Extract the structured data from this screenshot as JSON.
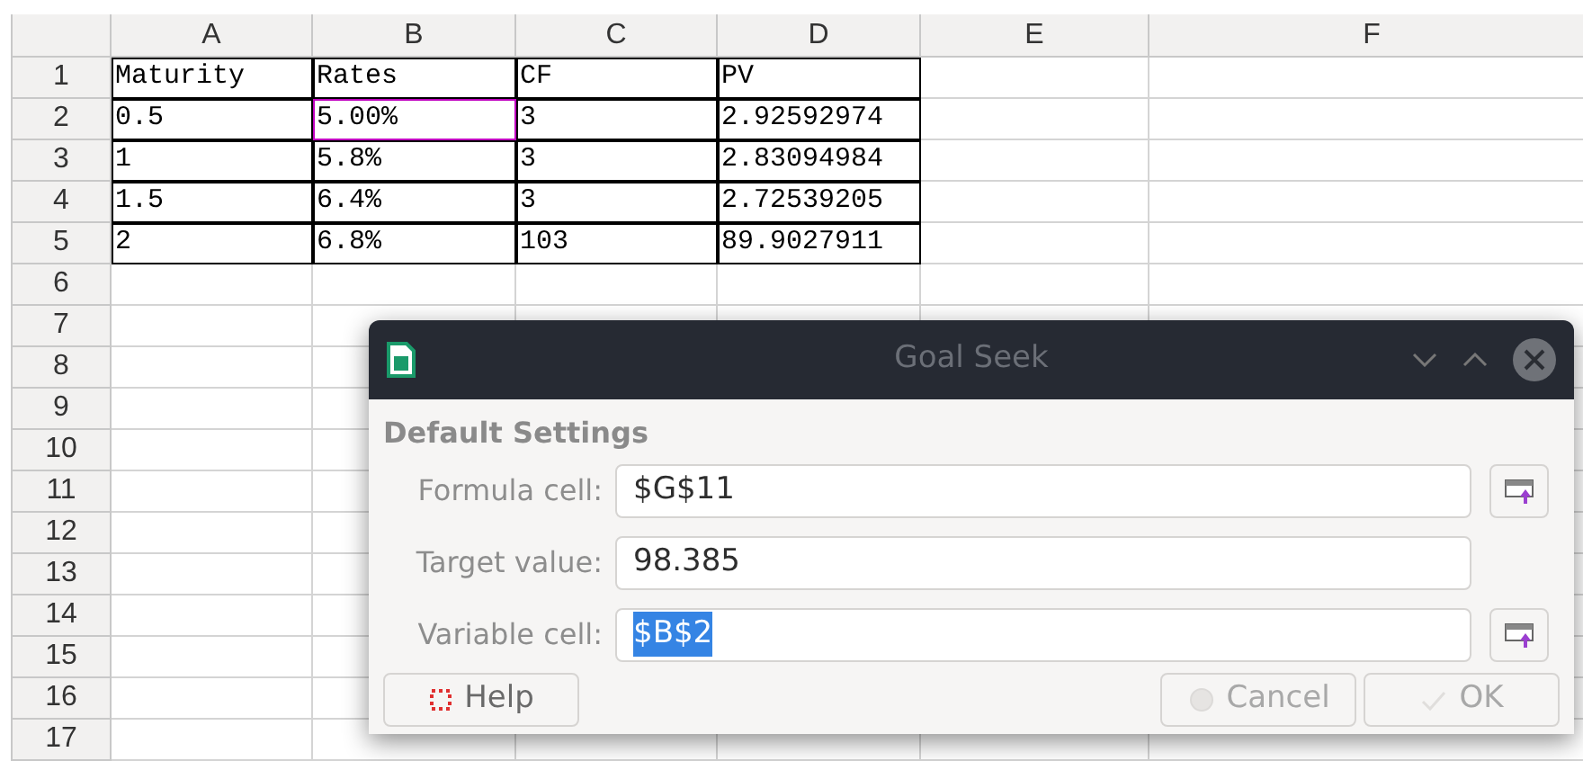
{
  "columns": [
    "A",
    "B",
    "C",
    "D",
    "E",
    "F"
  ],
  "rows": [
    {
      "header": "1",
      "cells": [
        {
          "text": "Maturity",
          "selected": false
        },
        {
          "text": "Rates",
          "selected": false
        },
        {
          "text": "CF",
          "selected": false
        },
        {
          "text": "PV",
          "selected": false
        }
      ]
    },
    {
      "header": "2",
      "cells": [
        {
          "text": "0.5",
          "selected": false
        },
        {
          "text": "5.00%",
          "selected": true
        },
        {
          "text": "3",
          "selected": false
        },
        {
          "text": "2.92592974",
          "selected": false
        }
      ]
    },
    {
      "header": "3",
      "cells": [
        {
          "text": "1",
          "selected": false
        },
        {
          "text": "5.8%",
          "selected": false
        },
        {
          "text": "3",
          "selected": false
        },
        {
          "text": "2.83094984",
          "selected": false
        }
      ]
    },
    {
      "header": "4",
      "cells": [
        {
          "text": "1.5",
          "selected": false
        },
        {
          "text": "6.4%",
          "selected": false
        },
        {
          "text": "3",
          "selected": false
        },
        {
          "text": "2.72539205",
          "selected": false
        }
      ]
    },
    {
      "header": "5",
      "cells": [
        {
          "text": "2",
          "selected": false
        },
        {
          "text": "6.8%",
          "selected": false
        },
        {
          "text": "103",
          "selected": false
        },
        {
          "text": "89.9027911",
          "selected": false
        }
      ]
    },
    {
      "header": "6"
    },
    {
      "header": "7"
    },
    {
      "header": "8"
    },
    {
      "header": "9"
    },
    {
      "header": "10"
    },
    {
      "header": "11"
    },
    {
      "header": "12"
    },
    {
      "header": "13"
    },
    {
      "header": "14"
    },
    {
      "header": "15"
    },
    {
      "header": "16"
    },
    {
      "header": "17"
    }
  ],
  "dialog": {
    "title": "Goal Seek",
    "section": "Default Settings",
    "fields": [
      {
        "label": "Formula cell:",
        "value": "$G$11",
        "kind": "reference",
        "value_selected": false
      },
      {
        "label": "Target value:",
        "value": "98.385",
        "kind": "plain",
        "value_selected": false
      },
      {
        "label": "Variable cell:",
        "value": "$B$2",
        "kind": "reference",
        "value_selected": true
      }
    ],
    "buttons": [
      {
        "label": "Help",
        "kind": "help",
        "disabled": false
      },
      {
        "label": "Cancel",
        "kind": "cancel",
        "disabled": true
      },
      {
        "label": "OK",
        "kind": "ok",
        "disabled": true
      }
    ]
  }
}
